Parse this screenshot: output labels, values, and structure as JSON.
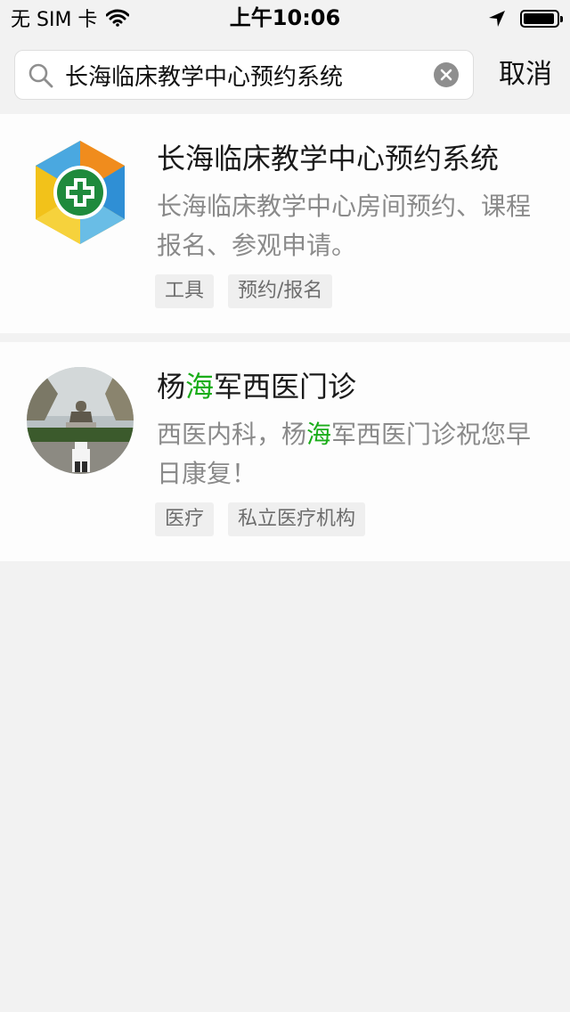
{
  "status_bar": {
    "carrier": "无 SIM 卡",
    "time": "上午10:06"
  },
  "search": {
    "query": "长海临床教学中心预约系统",
    "cancel_label": "取消"
  },
  "results": [
    {
      "title": "长海临床教学中心预约系统",
      "description": "长海临床教学中心房间预约、课程报名、参观申请。",
      "tags": [
        "工具",
        "预约/报名"
      ]
    },
    {
      "title_pre": "杨",
      "title_highlight": "海",
      "title_post": "军西医门诊",
      "desc_pre": "西医内科，杨",
      "desc_highlight": "海",
      "desc_post": "军西医门诊祝您早日康复！",
      "tags": [
        "医疗",
        "私立医疗机构"
      ]
    }
  ],
  "colors": {
    "highlight": "#1aad19",
    "background": "#f2f2f2"
  }
}
